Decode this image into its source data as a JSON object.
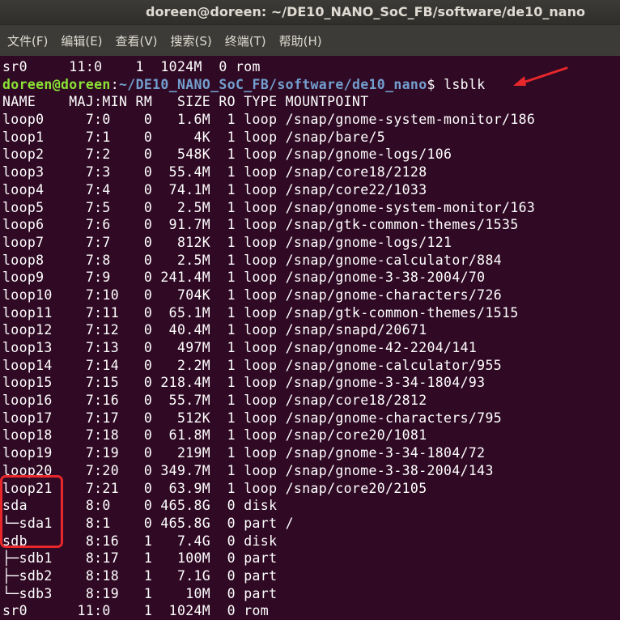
{
  "window": {
    "title": "doreen@doreen: ~/DE10_NANO_SoC_FB/software/de10_nano"
  },
  "menu": [
    {
      "label": "文件(F)"
    },
    {
      "label": "编辑(E)"
    },
    {
      "label": "查看(V)"
    },
    {
      "label": "搜索(S)"
    },
    {
      "label": "终端(T)"
    },
    {
      "label": "帮助(H)"
    }
  ],
  "terminal": {
    "first_line": "sr0     11:0    1  1024M  0 rom",
    "prompt": {
      "user": "doreen@doreen",
      "separator": ":",
      "path": "~/DE10_NANO_SoC_FB/software/de10_nano",
      "symbol": "$ ",
      "command": "lsblk"
    },
    "output_lines": [
      "NAME    MAJ:MIN RM   SIZE RO TYPE MOUNTPOINT",
      "loop0     7:0    0   1.6M  1 loop /snap/gnome-system-monitor/186",
      "loop1     7:1    0     4K  1 loop /snap/bare/5",
      "loop2     7:2    0   548K  1 loop /snap/gnome-logs/106",
      "loop3     7:3    0  55.4M  1 loop /snap/core18/2128",
      "loop4     7:4    0  74.1M  1 loop /snap/core22/1033",
      "loop5     7:5    0   2.5M  1 loop /snap/gnome-system-monitor/163",
      "loop6     7:6    0  91.7M  1 loop /snap/gtk-common-themes/1535",
      "loop7     7:7    0   812K  1 loop /snap/gnome-logs/121",
      "loop8     7:8    0   2.5M  1 loop /snap/gnome-calculator/884",
      "loop9     7:9    0 241.4M  1 loop /snap/gnome-3-38-2004/70",
      "loop10    7:10   0   704K  1 loop /snap/gnome-characters/726",
      "loop11    7:11   0  65.1M  1 loop /snap/gtk-common-themes/1515",
      "loop12    7:12   0  40.4M  1 loop /snap/snapd/20671",
      "loop13    7:13   0   497M  1 loop /snap/gnome-42-2204/141",
      "loop14    7:14   0   2.2M  1 loop /snap/gnome-calculator/955",
      "loop15    7:15   0 218.4M  1 loop /snap/gnome-3-34-1804/93",
      "loop16    7:16   0  55.7M  1 loop /snap/core18/2812",
      "loop17    7:17   0   512K  1 loop /snap/gnome-characters/795",
      "loop18    7:18   0  61.8M  1 loop /snap/core20/1081",
      "loop19    7:19   0   219M  1 loop /snap/gnome-3-34-1804/72",
      "loop20    7:20   0 349.7M  1 loop /snap/gnome-3-38-2004/143",
      "loop21    7:21   0  63.9M  1 loop /snap/core20/2105",
      "sda       8:0    0 465.8G  0 disk",
      "└─sda1    8:1    0 465.8G  0 part /",
      "sdb       8:16   1   7.4G  0 disk",
      "├─sdb1    8:17   1   100M  0 part",
      "├─sdb2    8:18   1   7.1G  0 part",
      "└─sdb3    8:19   1    10M  0 part",
      "sr0      11:0    1  1024M  0 rom"
    ]
  },
  "colors": {
    "terminal_bg": "#300a24",
    "prompt_user": "#8ae234",
    "prompt_path": "#729fcf",
    "annotation": "#e8272b"
  }
}
